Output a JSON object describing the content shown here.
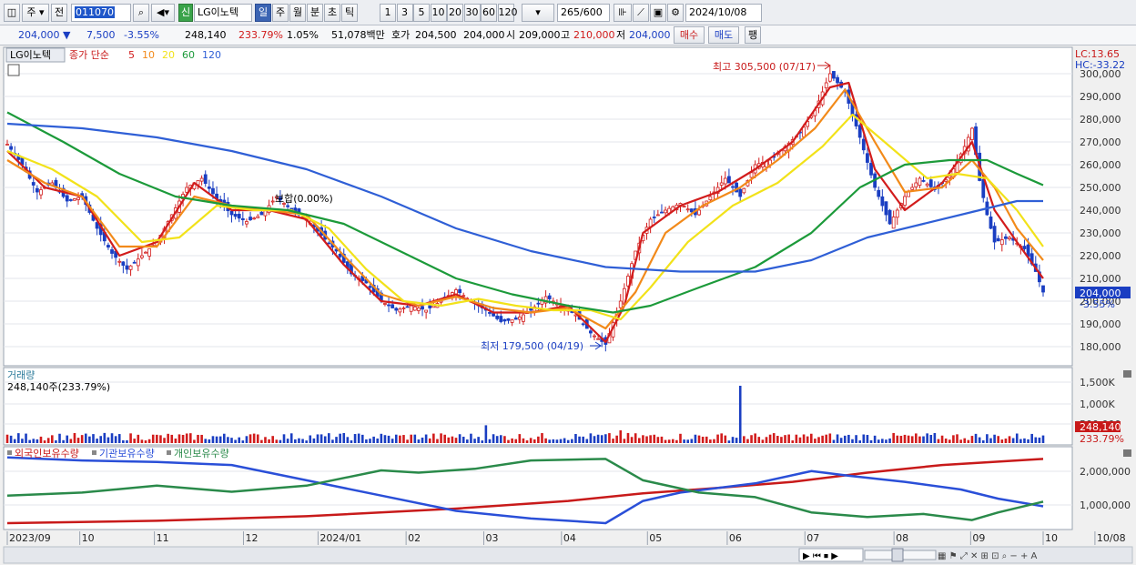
{
  "toolbar": {
    "period_unit": "주",
    "prev_label": "전",
    "stock_code": "011070",
    "new_badge": "신",
    "stock_name": "LG이노텍",
    "tf_day": "일",
    "tf_week": "주",
    "tf_month": "월",
    "tf_minute": "분",
    "tf_second": "초",
    "tf_tick": "틱",
    "intervals": [
      "1",
      "3",
      "5",
      "10",
      "20",
      "30",
      "60",
      "120"
    ],
    "count": "265",
    "count_total": "/600",
    "date": "2024/10/08"
  },
  "quote": {
    "price": "204,000",
    "change_arrow": "▼",
    "change": "7,500",
    "change_pct": "-3.55%",
    "volume": "248,140",
    "volume_ratio": "233.79%",
    "turnover_pct": "1.05%",
    "amount": "51,078백만",
    "ask_label": "호가",
    "ask": "204,500",
    "bid": "204,000",
    "open_label": "시",
    "open": "209,000",
    "high_label": "고",
    "high": "210,000",
    "low_label": "저",
    "low": "204,000",
    "buy_label": "매수",
    "sell_label": "매도",
    "popup_label": "팽"
  },
  "legend": {
    "name": "LG이노텍",
    "ma_prefix": "종가 단순",
    "ma": [
      {
        "period": "5",
        "color": "#d21c1c"
      },
      {
        "period": "10",
        "color": "#f28a1a"
      },
      {
        "period": "20",
        "color": "#f2e21a"
      },
      {
        "period": "60",
        "color": "#1c9a3a"
      },
      {
        "period": "120",
        "color": "#2f5fd6"
      }
    ]
  },
  "annotations": {
    "high": "최고 305,500 (07/17)",
    "low": "최저 179,500 (04/19)",
    "flat": "보합(0.00%)",
    "lc": "LC:13.65",
    "hc": "HC:-33.22",
    "last_price": "204,000",
    "last_change": "-3.55%"
  },
  "volume_panel": {
    "title": "거래량",
    "value": "248,140주(233.79%)",
    "last": "248,140",
    "last_pct": "233.79%"
  },
  "holdings_panel": {
    "series": [
      {
        "name": "외국인보유수량",
        "color": "#c81a1a"
      },
      {
        "name": "기관보유수량",
        "color": "#2a4fd8"
      },
      {
        "name": "개인보유수량",
        "color": "#2a8a4a"
      }
    ]
  },
  "x_axis_labels": [
    {
      "label": "2023/09",
      "pos": 0.0
    },
    {
      "label": "10",
      "pos": 0.07
    },
    {
      "label": "11",
      "pos": 0.142
    },
    {
      "label": "12",
      "pos": 0.228
    },
    {
      "label": "2024/01",
      "pos": 0.3
    },
    {
      "label": "02",
      "pos": 0.385
    },
    {
      "label": "03",
      "pos": 0.46
    },
    {
      "label": "04",
      "pos": 0.535
    },
    {
      "label": "05",
      "pos": 0.618
    },
    {
      "label": "06",
      "pos": 0.695
    },
    {
      "label": "07",
      "pos": 0.77
    },
    {
      "label": "08",
      "pos": 0.856
    },
    {
      "label": "09",
      "pos": 0.93
    },
    {
      "label": "10",
      "pos": 1.0
    },
    {
      "label": "10/08",
      "pos": 1.05
    }
  ],
  "chart_data": {
    "type": "candlestick",
    "title": "LG이노텍",
    "price_axis": {
      "ticks": [
        180000,
        190000,
        200000,
        210000,
        220000,
        230000,
        240000,
        250000,
        260000,
        270000,
        280000,
        290000,
        300000
      ]
    },
    "volume_axis": {
      "ticks": [
        "500,000",
        "1,000K",
        "1,500K"
      ]
    },
    "holdings_axis": {
      "ticks": [
        "1,000,000",
        "2,000,000"
      ]
    },
    "price_path": [
      [
        0,
        269000
      ],
      [
        4,
        260000
      ],
      [
        8,
        248000
      ],
      [
        12,
        252000
      ],
      [
        16,
        244000
      ],
      [
        20,
        246000
      ],
      [
        24,
        232000
      ],
      [
        28,
        221000
      ],
      [
        32,
        214000
      ],
      [
        36,
        220000
      ],
      [
        40,
        226000
      ],
      [
        44,
        238000
      ],
      [
        48,
        250000
      ],
      [
        52,
        254000
      ],
      [
        56,
        245000
      ],
      [
        60,
        238000
      ],
      [
        64,
        235000
      ],
      [
        68,
        238000
      ],
      [
        72,
        246000
      ],
      [
        76,
        240000
      ],
      [
        80,
        236000
      ],
      [
        84,
        229000
      ],
      [
        88,
        222000
      ],
      [
        92,
        212000
      ],
      [
        96,
        208000
      ],
      [
        100,
        200000
      ],
      [
        104,
        196000
      ],
      [
        108,
        198000
      ],
      [
        112,
        196000
      ],
      [
        116,
        200000
      ],
      [
        120,
        205000
      ],
      [
        124,
        200000
      ],
      [
        128,
        196000
      ],
      [
        132,
        191000
      ],
      [
        136,
        192000
      ],
      [
        140,
        196000
      ],
      [
        144,
        202000
      ],
      [
        148,
        198000
      ],
      [
        152,
        194000
      ],
      [
        156,
        186000
      ],
      [
        160,
        181000
      ],
      [
        164,
        200000
      ],
      [
        168,
        222000
      ],
      [
        172,
        236000
      ],
      [
        176,
        240000
      ],
      [
        180,
        243000
      ],
      [
        184,
        238000
      ],
      [
        188,
        246000
      ],
      [
        192,
        254000
      ],
      [
        196,
        246000
      ],
      [
        200,
        260000
      ],
      [
        204,
        262000
      ],
      [
        208,
        268000
      ],
      [
        212,
        274000
      ],
      [
        216,
        284000
      ],
      [
        220,
        300000
      ],
      [
        224,
        292000
      ],
      [
        228,
        272000
      ],
      [
        232,
        250000
      ],
      [
        236,
        234000
      ],
      [
        240,
        246000
      ],
      [
        244,
        254000
      ],
      [
        248,
        249000
      ],
      [
        252,
        255000
      ],
      [
        256,
        268000
      ],
      [
        258,
        276000
      ],
      [
        260,
        253000
      ],
      [
        262,
        238000
      ],
      [
        264,
        226000
      ],
      [
        268,
        228000
      ],
      [
        272,
        223000
      ],
      [
        275,
        213000
      ],
      [
        277,
        204000
      ]
    ],
    "ma_series": [
      {
        "name": "5",
        "color": "#d21c1c",
        "points": [
          [
            0,
            266000
          ],
          [
            10,
            250000
          ],
          [
            20,
            246000
          ],
          [
            30,
            220000
          ],
          [
            40,
            226000
          ],
          [
            50,
            252000
          ],
          [
            60,
            240000
          ],
          [
            70,
            240000
          ],
          [
            80,
            236000
          ],
          [
            90,
            216000
          ],
          [
            100,
            200000
          ],
          [
            110,
            198000
          ],
          [
            120,
            203000
          ],
          [
            130,
            195000
          ],
          [
            140,
            195000
          ],
          [
            150,
            198000
          ],
          [
            160,
            182000
          ],
          [
            165,
            198000
          ],
          [
            170,
            230000
          ],
          [
            180,
            242000
          ],
          [
            190,
            248000
          ],
          [
            200,
            258000
          ],
          [
            210,
            270000
          ],
          [
            220,
            294000
          ],
          [
            225,
            296000
          ],
          [
            232,
            258000
          ],
          [
            240,
            240000
          ],
          [
            250,
            252000
          ],
          [
            258,
            270000
          ],
          [
            264,
            240000
          ],
          [
            270,
            226000
          ],
          [
            277,
            210000
          ]
        ]
      },
      {
        "name": "10",
        "color": "#f28a1a",
        "points": [
          [
            0,
            262000
          ],
          [
            10,
            252000
          ],
          [
            20,
            246000
          ],
          [
            30,
            224000
          ],
          [
            40,
            224000
          ],
          [
            50,
            246000
          ],
          [
            60,
            242000
          ],
          [
            70,
            240000
          ],
          [
            80,
            238000
          ],
          [
            90,
            220000
          ],
          [
            100,
            203000
          ],
          [
            110,
            198000
          ],
          [
            120,
            202000
          ],
          [
            130,
            197000
          ],
          [
            140,
            195000
          ],
          [
            150,
            197000
          ],
          [
            160,
            188000
          ],
          [
            168,
            204000
          ],
          [
            176,
            230000
          ],
          [
            186,
            242000
          ],
          [
            196,
            250000
          ],
          [
            206,
            262000
          ],
          [
            216,
            276000
          ],
          [
            224,
            293000
          ],
          [
            232,
            270000
          ],
          [
            240,
            248000
          ],
          [
            250,
            250000
          ],
          [
            258,
            262000
          ],
          [
            264,
            250000
          ],
          [
            270,
            232000
          ],
          [
            277,
            218000
          ]
        ]
      },
      {
        "name": "20",
        "color": "#f2e21a",
        "points": [
          [
            0,
            266000
          ],
          [
            12,
            258000
          ],
          [
            24,
            246000
          ],
          [
            36,
            226000
          ],
          [
            46,
            228000
          ],
          [
            56,
            242000
          ],
          [
            66,
            240000
          ],
          [
            76,
            240000
          ],
          [
            86,
            232000
          ],
          [
            96,
            214000
          ],
          [
            106,
            200000
          ],
          [
            116,
            198000
          ],
          [
            126,
            201000
          ],
          [
            136,
            198000
          ],
          [
            146,
            196000
          ],
          [
            156,
            196000
          ],
          [
            164,
            192000
          ],
          [
            172,
            206000
          ],
          [
            182,
            226000
          ],
          [
            194,
            242000
          ],
          [
            206,
            252000
          ],
          [
            218,
            268000
          ],
          [
            226,
            282000
          ],
          [
            236,
            268000
          ],
          [
            246,
            254000
          ],
          [
            254,
            256000
          ],
          [
            262,
            254000
          ],
          [
            270,
            240000
          ],
          [
            277,
            224000
          ]
        ]
      },
      {
        "name": "60",
        "color": "#1c9a3a",
        "points": [
          [
            0,
            283000
          ],
          [
            15,
            270000
          ],
          [
            30,
            256000
          ],
          [
            45,
            246000
          ],
          [
            60,
            242000
          ],
          [
            75,
            240000
          ],
          [
            90,
            234000
          ],
          [
            105,
            222000
          ],
          [
            120,
            210000
          ],
          [
            135,
            203000
          ],
          [
            150,
            198000
          ],
          [
            162,
            195000
          ],
          [
            172,
            198000
          ],
          [
            185,
            206000
          ],
          [
            200,
            215000
          ],
          [
            215,
            230000
          ],
          [
            228,
            250000
          ],
          [
            240,
            260000
          ],
          [
            252,
            262000
          ],
          [
            262,
            262000
          ],
          [
            270,
            256000
          ],
          [
            277,
            251000
          ]
        ]
      },
      {
        "name": "120",
        "color": "#2f5fd6",
        "points": [
          [
            0,
            278000
          ],
          [
            20,
            276000
          ],
          [
            40,
            272000
          ],
          [
            60,
            266000
          ],
          [
            80,
            258000
          ],
          [
            100,
            246000
          ],
          [
            120,
            232000
          ],
          [
            140,
            222000
          ],
          [
            160,
            215000
          ],
          [
            180,
            213000
          ],
          [
            200,
            213000
          ],
          [
            215,
            218000
          ],
          [
            230,
            228000
          ],
          [
            245,
            234000
          ],
          [
            260,
            240000
          ],
          [
            270,
            244000
          ],
          [
            277,
            244000
          ]
        ]
      }
    ],
    "volume": {
      "baseline": "small",
      "spikes": [
        {
          "i": 128,
          "v": 0.28
        },
        {
          "i": 164,
          "v": 0.2
        },
        {
          "i": 196,
          "v": 0.9
        },
        {
          "i": 277,
          "v": 0.12
        }
      ]
    },
    "holdings": [
      {
        "name": "외국인보유수량",
        "points": [
          [
            0,
            0.06
          ],
          [
            40,
            0.09
          ],
          [
            80,
            0.15
          ],
          [
            120,
            0.25
          ],
          [
            150,
            0.35
          ],
          [
            170,
            0.45
          ],
          [
            190,
            0.52
          ],
          [
            210,
            0.6
          ],
          [
            230,
            0.72
          ],
          [
            250,
            0.82
          ],
          [
            277,
            0.9
          ]
        ]
      },
      {
        "name": "기관보유수량",
        "points": [
          [
            0,
            0.92
          ],
          [
            20,
            0.88
          ],
          [
            40,
            0.86
          ],
          [
            60,
            0.82
          ],
          [
            80,
            0.62
          ],
          [
            100,
            0.42
          ],
          [
            120,
            0.22
          ],
          [
            140,
            0.12
          ],
          [
            160,
            0.06
          ],
          [
            170,
            0.35
          ],
          [
            180,
            0.46
          ],
          [
            200,
            0.58
          ],
          [
            215,
            0.74
          ],
          [
            225,
            0.68
          ],
          [
            240,
            0.6
          ],
          [
            255,
            0.5
          ],
          [
            265,
            0.38
          ],
          [
            277,
            0.28
          ]
        ]
      },
      {
        "name": "개인보유수량",
        "points": [
          [
            0,
            0.42
          ],
          [
            20,
            0.46
          ],
          [
            40,
            0.55
          ],
          [
            60,
            0.47
          ],
          [
            80,
            0.55
          ],
          [
            100,
            0.75
          ],
          [
            110,
            0.72
          ],
          [
            125,
            0.77
          ],
          [
            140,
            0.88
          ],
          [
            160,
            0.9
          ],
          [
            170,
            0.62
          ],
          [
            185,
            0.46
          ],
          [
            200,
            0.4
          ],
          [
            215,
            0.2
          ],
          [
            230,
            0.14
          ],
          [
            245,
            0.18
          ],
          [
            258,
            0.1
          ],
          [
            265,
            0.2
          ],
          [
            277,
            0.34
          ]
        ]
      }
    ]
  }
}
